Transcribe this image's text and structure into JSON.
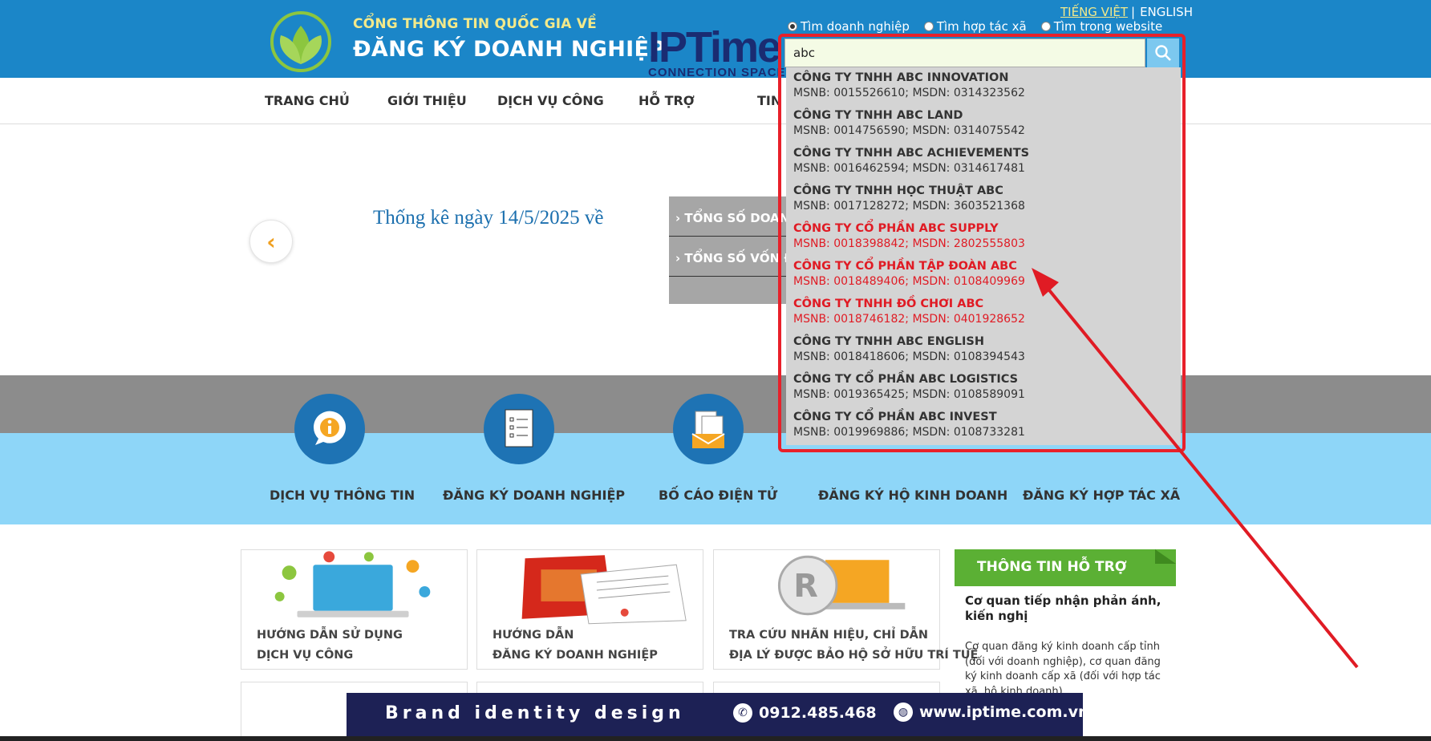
{
  "header": {
    "subtitle": "CỔNG THÔNG TIN QUỐC GIA VỀ",
    "title": "ĐĂNG KÝ DOANH NGHIỆP",
    "partner_logo": "IPTime",
    "partner_tagline": "CONNECTION SPACE",
    "lang_vi": "TIẾNG VIỆT",
    "lang_sep": "|",
    "lang_en": "ENGLISH",
    "search_options": [
      "Tìm doanh nghiệp",
      "Tìm hợp tác xã",
      "Tìm trong website"
    ],
    "search_value": "abc"
  },
  "nav": {
    "items": [
      "TRANG CHỦ",
      "GIỚI THIỆU",
      "DỊCH VỤ CÔNG",
      "HỖ TRỢ",
      "TIN"
    ]
  },
  "banner": {
    "stat_title": "Thống kê ngày 14/5/2025 về",
    "stat_rows": [
      "TỔNG SỐ DOANH N",
      "TỔNG SỐ VỐN ĐĂ"
    ]
  },
  "services": [
    "DỊCH VỤ THÔNG TIN",
    "ĐĂNG KÝ DOANH NGHIỆP",
    "BỐ CÁO ĐIỆN TỬ",
    "ĐĂNG KÝ HỘ KINH DOANH",
    "ĐĂNG KÝ HỢP TÁC XÃ"
  ],
  "cards": [
    {
      "line1": "HƯỚNG DẪN SỬ DỤNG",
      "line2": "DỊCH VỤ CÔNG"
    },
    {
      "line1": "HƯỚNG DẪN",
      "line2": "ĐĂNG KÝ DOANH NGHIỆP"
    },
    {
      "line1": "TRA CỨU NHÃN HIỆU, CHỈ DẪN",
      "line2": "ĐỊA LÝ ĐƯỢC BẢO HỘ SỞ HỮU TRÍ TUỆ"
    }
  ],
  "support": {
    "heading": "THÔNG TIN HỖ TRỢ",
    "question": "Cơ quan tiếp nhận phản ánh, kiến nghị",
    "answer": "Cơ quan đăng ký kinh doanh cấp tỉnh (đối với doanh nghiệp), cơ quan đăng ký kinh doanh cấp xã (đối với hợp tác xã, hộ kinh doanh)."
  },
  "dropdown": [
    {
      "name": "CÔNG TY TNHH ABC INNOVATION",
      "meta": "MSNB: 0015526610; MSDN: 0314323562",
      "highlight": false
    },
    {
      "name": "CÔNG TY TNHH ABC LAND",
      "meta": "MSNB: 0014756590; MSDN: 0314075542",
      "highlight": false
    },
    {
      "name": "CÔNG TY TNHH ABC ACHIEVEMENTS",
      "meta": "MSNB: 0016462594; MSDN: 0314617481",
      "highlight": false
    },
    {
      "name": "CÔNG TY TNHH HỌC THUẬT ABC",
      "meta": "MSNB: 0017128272; MSDN: 3603521368",
      "highlight": false
    },
    {
      "name": "CÔNG TY CỔ PHẦN ABC SUPPLY",
      "meta": "MSNB: 0018398842; MSDN: 2802555803",
      "highlight": true
    },
    {
      "name": "CÔNG TY CỔ PHẦN TẬP ĐOÀN ABC",
      "meta": "MSNB: 0018489406; MSDN: 0108409969",
      "highlight": true
    },
    {
      "name": "CÔNG TY TNHH ĐỒ CHƠI ABC",
      "meta": "MSNB: 0018746182; MSDN: 0401928652",
      "highlight": true
    },
    {
      "name": "CÔNG TY TNHH ABC ENGLISH",
      "meta": "MSNB: 0018418606; MSDN: 0108394543",
      "highlight": false
    },
    {
      "name": "CÔNG TY CỔ PHẦN ABC LOGISTICS",
      "meta": "MSNB: 0019365425; MSDN: 0108589091",
      "highlight": false
    },
    {
      "name": "CÔNG TY CỔ PHẦN ABC INVEST",
      "meta": "MSNB: 0019969886; MSDN: 0108733281",
      "highlight": false
    }
  ],
  "brand_strip": {
    "slogan": "Brand identity design",
    "phone": "0912.485.468",
    "website": "www.iptime.com.vn"
  },
  "colors": {
    "header_blue": "#1b86c8",
    "accent_yellow": "#f3e98a",
    "highlight_red": "#e01b24",
    "support_green": "#5bb034"
  }
}
